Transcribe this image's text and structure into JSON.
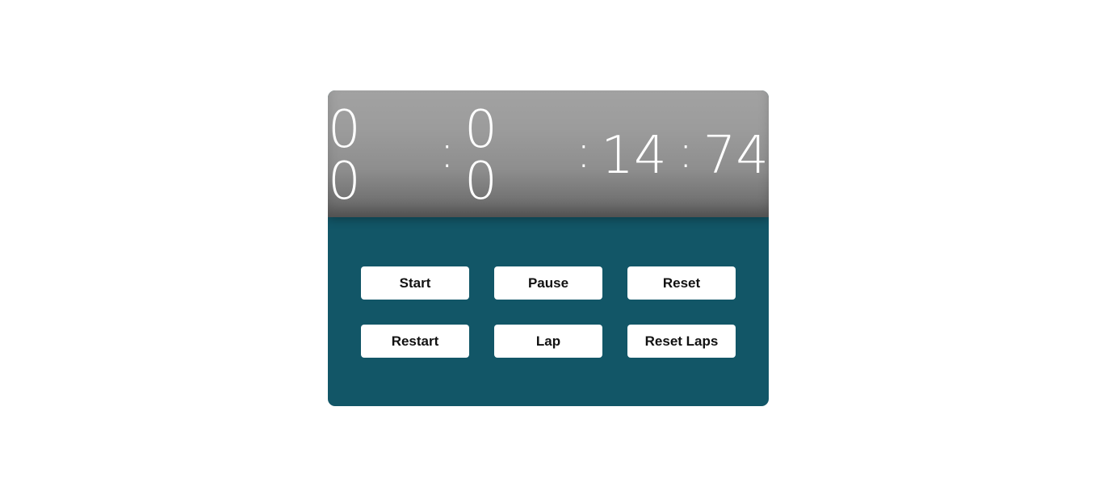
{
  "display": {
    "hours": "0 0",
    "minutes": "0 0",
    "seconds": "14",
    "centiseconds": "74",
    "separator": ":"
  },
  "controls": {
    "start": "Start",
    "pause": "Pause",
    "reset": "Reset",
    "restart": "Restart",
    "lap": "Lap",
    "reset_laps": "Reset Laps"
  },
  "colors": {
    "panel": "#125667",
    "display_top": "#a2a2a2",
    "display_bottom": "#5f5f5f",
    "button_bg": "#ffffff",
    "button_text": "#111111",
    "time_text": "#ffffff"
  }
}
